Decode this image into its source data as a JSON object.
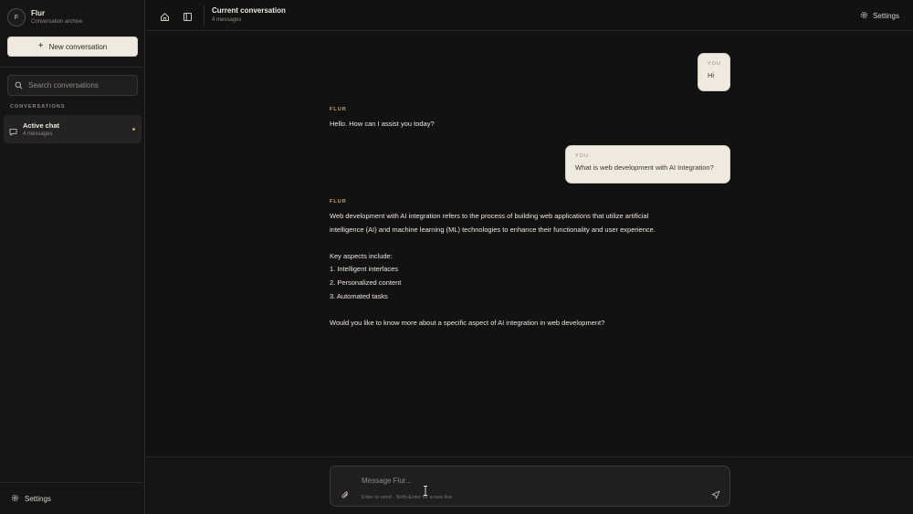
{
  "sidebar": {
    "brand_initial": "F",
    "brand_name": "Flur",
    "brand_subtitle": "Conversation archive",
    "new_conversation_label": "New conversation",
    "search_placeholder": "Search conversations",
    "section_label": "CONVERSATIONS",
    "conversations": [
      {
        "title": "Active chat",
        "subtitle": "4 messages",
        "active": true
      }
    ],
    "settings_label": "Settings"
  },
  "topbar": {
    "title": "Current conversation",
    "subtitle": "4 messages",
    "settings_label": "Settings"
  },
  "messages": [
    {
      "role": "user",
      "author": "YOU",
      "text": "Hi"
    },
    {
      "role": "assistant",
      "author": "FLUR",
      "text": "Hello. How can I assist you today?"
    },
    {
      "role": "user",
      "author": "YOU",
      "text": "What is web development with AI Integration?"
    },
    {
      "role": "assistant",
      "author": "FLUR",
      "lines": [
        "Web development with AI integration refers to the process of building web applications that utilize artificial",
        "intelligence (AI) and machine learning (ML) technologies to enhance their functionality and user experience.",
        "",
        "Key aspects include:",
        "1. Intelligent interfaces",
        "2. Personalized content",
        "3. Automated tasks",
        "",
        "Would you like to know more about a specific aspect of AI integration in web development?"
      ]
    }
  ],
  "composer": {
    "placeholder": "Message Flur...",
    "hint": "Enter to send · Shift+Enter for a new line"
  },
  "colors": {
    "background": "#121212",
    "accent": "#c9a35a",
    "user_bubble": "#efeadf"
  }
}
